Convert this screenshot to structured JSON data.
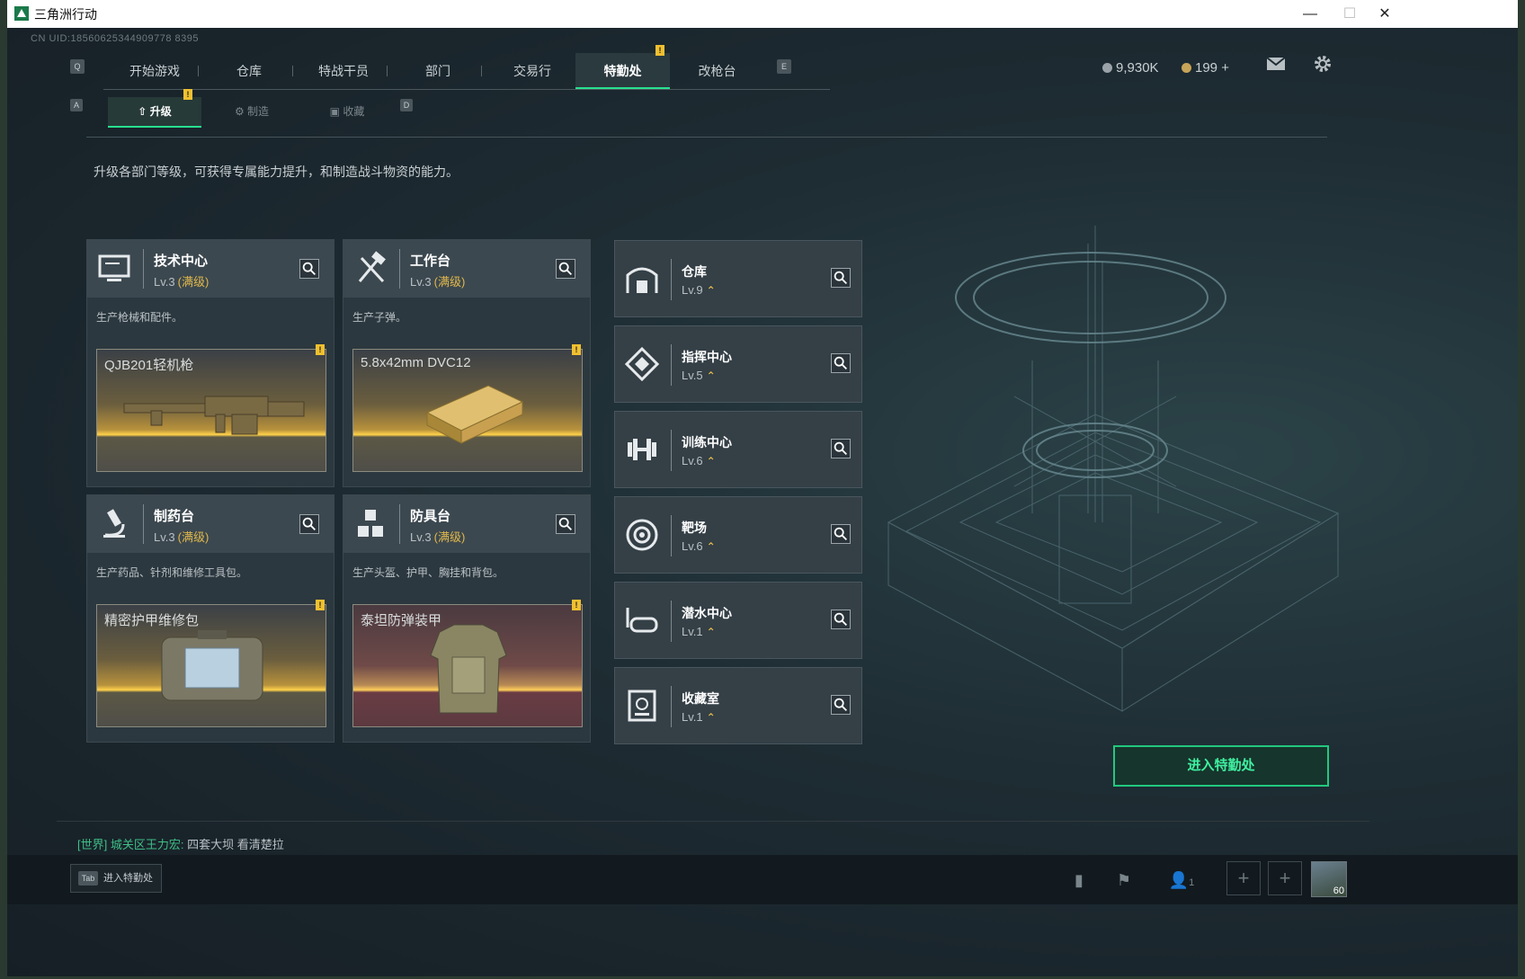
{
  "window": {
    "title": "三角洲行动",
    "minimize": "—",
    "maximize": "☐",
    "close": "✕"
  },
  "uid": "CN UID:18560625344909778 8395",
  "topnav": {
    "key_left": "Q",
    "key_right": "E",
    "tabs": [
      {
        "label": "开始游戏"
      },
      {
        "label": "仓库"
      },
      {
        "label": "特战干员"
      },
      {
        "label": "部门"
      },
      {
        "label": "交易行"
      },
      {
        "label": "特勤处",
        "active": true,
        "notice": "!"
      },
      {
        "label": "改枪台"
      }
    ]
  },
  "currency": {
    "silver": "9,930K",
    "gold": "199 +"
  },
  "subnav": {
    "key_left": "A",
    "key_right": "D",
    "tabs": [
      {
        "label": "升级",
        "active": true,
        "notice": "!"
      },
      {
        "label": "制造"
      },
      {
        "label": "收藏"
      }
    ]
  },
  "description": "升级各部门等级，可获得专属能力提升，和制造战斗物资的能力。",
  "facilities": [
    {
      "name": "技术中心",
      "level": "Lv.3",
      "max": "(满级)",
      "desc": "生产枪械和配件。",
      "product": "QJB201轻机枪",
      "icon": "computer-icon"
    },
    {
      "name": "工作台",
      "level": "Lv.3",
      "max": "(满级)",
      "desc": "生产子弹。",
      "product": "5.8x42mm DVC12",
      "icon": "tools-icon"
    },
    {
      "name": "制药台",
      "level": "Lv.3",
      "max": "(满级)",
      "desc": "生产药品、针剂和维修工具包。",
      "product": "精密护甲维修包",
      "icon": "microscope-icon"
    },
    {
      "name": "防具台",
      "level": "Lv.3",
      "max": "(满级)",
      "desc": "生产头盔、护甲、胸挂和背包。",
      "product": "泰坦防弹装甲",
      "icon": "cubes-icon"
    }
  ],
  "rooms": [
    {
      "name": "仓库",
      "level": "Lv.9",
      "icon": "warehouse-icon"
    },
    {
      "name": "指挥中心",
      "level": "Lv.5",
      "icon": "command-icon"
    },
    {
      "name": "训练中心",
      "level": "Lv.6",
      "icon": "dumbbell-icon"
    },
    {
      "name": "靶场",
      "level": "Lv.6",
      "icon": "target-icon"
    },
    {
      "name": "潜水中心",
      "level": "Lv.1",
      "icon": "diving-mask-icon"
    },
    {
      "name": "收藏室",
      "level": "Lv.1",
      "icon": "collection-icon"
    }
  ],
  "enter_button": "进入特勤处",
  "chat": {
    "channel": "[世界]",
    "sender": "城关区王力宏:",
    "message": "四套大坝 看清楚拉"
  },
  "tab_hint": {
    "key": "Tab",
    "label": "进入特勤处"
  },
  "bottom": {
    "friends_count": "1",
    "avatar_level": "60"
  },
  "colors": {
    "accent": "#28e08f",
    "gold": "#e0b84a",
    "notice": "#f0c030"
  }
}
